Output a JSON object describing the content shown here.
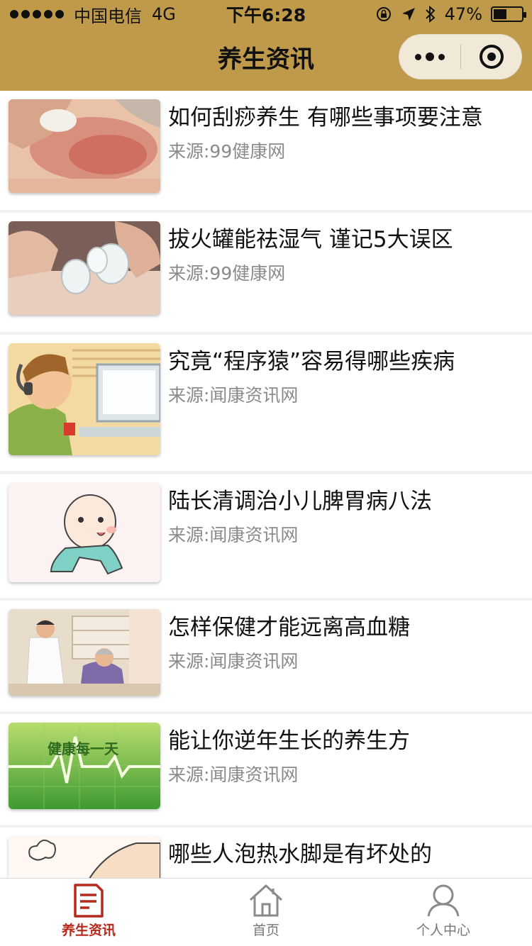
{
  "status_bar": {
    "carrier": "中国电信",
    "network": "4G",
    "time": "下午6:28",
    "battery_text": "47%",
    "battery_level": 0.47
  },
  "nav": {
    "title": "养生资讯"
  },
  "articles": [
    {
      "title": "如何刮痧养生 有哪些事项要注意",
      "source": "来源:99健康网",
      "thumb": "gua-sha-back-photo"
    },
    {
      "title": "拔火罐能祛湿气 谨记5大误区",
      "source": "来源:99健康网",
      "thumb": "cupping-glass-photo"
    },
    {
      "title": "究竟“程序猿”容易得哪些疾病",
      "source": "来源:闻康资讯网",
      "thumb": "programmer-cartoon"
    },
    {
      "title": "陆长清调治小儿脾胃病八法",
      "source": "来源:闻康资讯网",
      "thumb": "baby-cartoon"
    },
    {
      "title": "怎样保健才能远离高血糖",
      "source": "来源:闻康资讯网",
      "thumb": "doctor-patient-photo"
    },
    {
      "title": "能让你逆年生长的养生方",
      "source": "来源:闻康资讯网",
      "thumb": "ecg-green-banner",
      "thumb_text": "健康每一天"
    },
    {
      "title": "哪些人泡热水脚是有坏处的",
      "source": "",
      "thumb": "foot-cartoon"
    }
  ],
  "tabbar": {
    "tabs": [
      {
        "label": "养生资讯",
        "icon": "document-icon",
        "active": true
      },
      {
        "label": "首页",
        "icon": "home-icon",
        "active": false
      },
      {
        "label": "个人中心",
        "icon": "person-icon",
        "active": false
      }
    ]
  },
  "colors": {
    "header": "#c09a4b",
    "active_tab": "#b62a1c",
    "source_text": "#8a8a8a"
  }
}
